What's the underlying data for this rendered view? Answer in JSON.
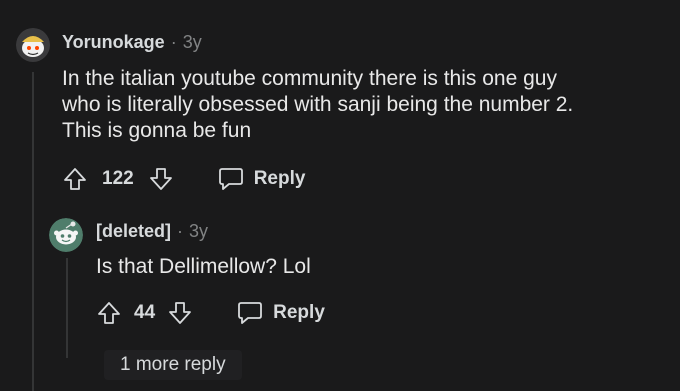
{
  "comment1": {
    "username": "Yorunokage",
    "separator": "·",
    "age": "3y",
    "body_lines": [
      "In the italian youtube community there is this one guy",
      "who is literally obsessed with sanji being the number 2.",
      "This is gonna be fun"
    ],
    "vote_count": "122",
    "reply_label": "Reply"
  },
  "comment2": {
    "username": "[deleted]",
    "separator": "·",
    "age": "3y",
    "body": "Is that Dellimellow? Lol",
    "vote_count": "44",
    "reply_label": "Reply",
    "more_replies_label": "1 more reply"
  },
  "icons": {
    "upvote": "arrow-up-outline",
    "downvote": "arrow-down-outline",
    "reply": "speech-bubble-outline"
  },
  "colors": {
    "background": "#1a1a1b",
    "text": "#d7dadc",
    "muted": "#818384",
    "thread_line": "#343536"
  }
}
